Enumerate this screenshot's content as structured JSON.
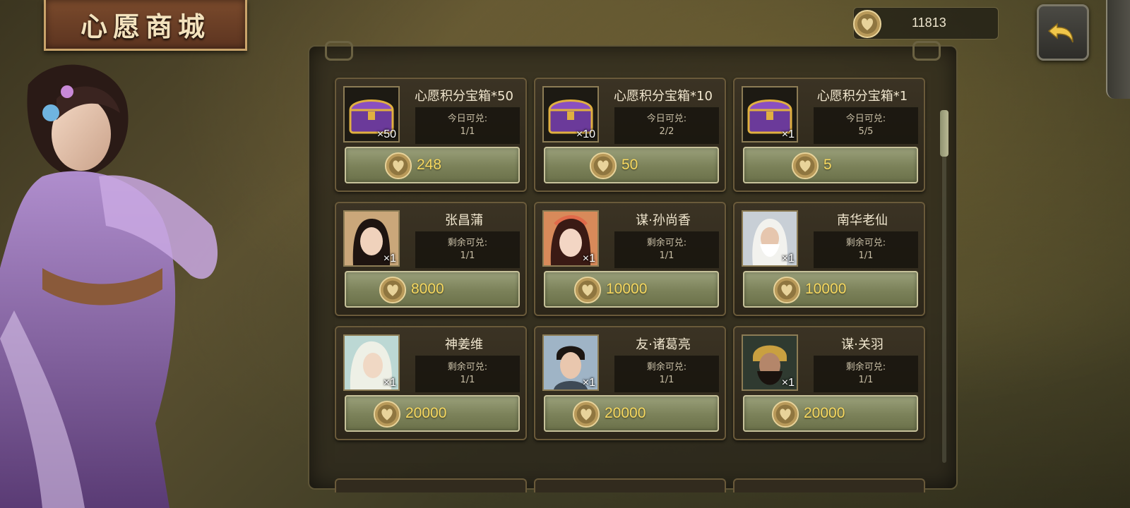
{
  "title": "心愿商城",
  "currency": {
    "amount": "11813",
    "icon": "heart-coin-icon"
  },
  "back": {
    "icon": "undo-arrow-icon"
  },
  "items": [
    {
      "name": "心愿积分宝箱*50",
      "quantity": "×50",
      "limit_label": "今日可兑:",
      "limit_value": "1/1",
      "price": "248",
      "icon": "treasure-chest-icon"
    },
    {
      "name": "心愿积分宝箱*10",
      "quantity": "×10",
      "limit_label": "今日可兑:",
      "limit_value": "2/2",
      "price": "50",
      "icon": "treasure-chest-icon"
    },
    {
      "name": "心愿积分宝箱*1",
      "quantity": "×1",
      "limit_label": "今日可兑:",
      "limit_value": "5/5",
      "price": "5",
      "icon": "treasure-chest-icon"
    },
    {
      "name": "张昌蒲",
      "quantity": "×1",
      "limit_label": "剩余可兑:",
      "limit_value": "1/1",
      "price": "8000",
      "icon": "hero-portrait-icon"
    },
    {
      "name": "谋·孙尚香",
      "quantity": "×1",
      "limit_label": "剩余可兑:",
      "limit_value": "1/1",
      "price": "10000",
      "icon": "hero-portrait-icon"
    },
    {
      "name": "南华老仙",
      "quantity": "×1",
      "limit_label": "剩余可兑:",
      "limit_value": "1/1",
      "price": "10000",
      "icon": "hero-portrait-icon"
    },
    {
      "name": "神姜维",
      "quantity": "×1",
      "limit_label": "剩余可兑:",
      "limit_value": "1/1",
      "price": "20000",
      "icon": "hero-portrait-icon"
    },
    {
      "name": "友·诸葛亮",
      "quantity": "×1",
      "limit_label": "剩余可兑:",
      "limit_value": "1/1",
      "price": "20000",
      "icon": "hero-portrait-icon"
    },
    {
      "name": "谋·关羽",
      "quantity": "×1",
      "limit_label": "剩余可兑:",
      "limit_value": "1/1",
      "price": "20000",
      "icon": "hero-portrait-icon"
    }
  ],
  "colors": {
    "price": "#f6d860",
    "button": "#7b8159",
    "panel": "#2c2619"
  }
}
